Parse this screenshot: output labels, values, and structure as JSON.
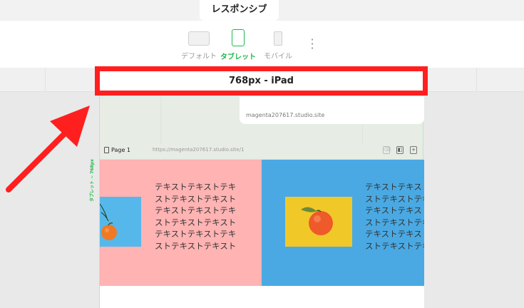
{
  "tabs": {
    "active": "レスポンシブ"
  },
  "devices": [
    {
      "label": "デフォルト",
      "icon": "desktop-icon"
    },
    {
      "label": "タブレット",
      "icon": "tablet-icon"
    },
    {
      "label": "モバイル",
      "icon": "mobile-icon"
    }
  ],
  "breakpoint_label": "768px - iPad",
  "site_url": "magenta207617.studio.site",
  "page": {
    "name": "Page 1",
    "url": "https://magenta207617.studio.site/1"
  },
  "side_label": "タブレット ~ 768px",
  "content": {
    "text_pink": "テキストテキストテキストテキストテキストテキストテキストテキストテキストテキストテキストテキストテキストテキストテキスト",
    "text_blue": "テキストテキストテキストテキストテキストテキストテキストテキストテキストテキストテキストテキストテキストテキストテキスト"
  },
  "colors": {
    "accent_green": "#1fb84a",
    "highlight_red": "#ff1f1f",
    "pink": "#ffb3b3",
    "blue": "#4aa9e3",
    "yellow": "#f0c928"
  }
}
